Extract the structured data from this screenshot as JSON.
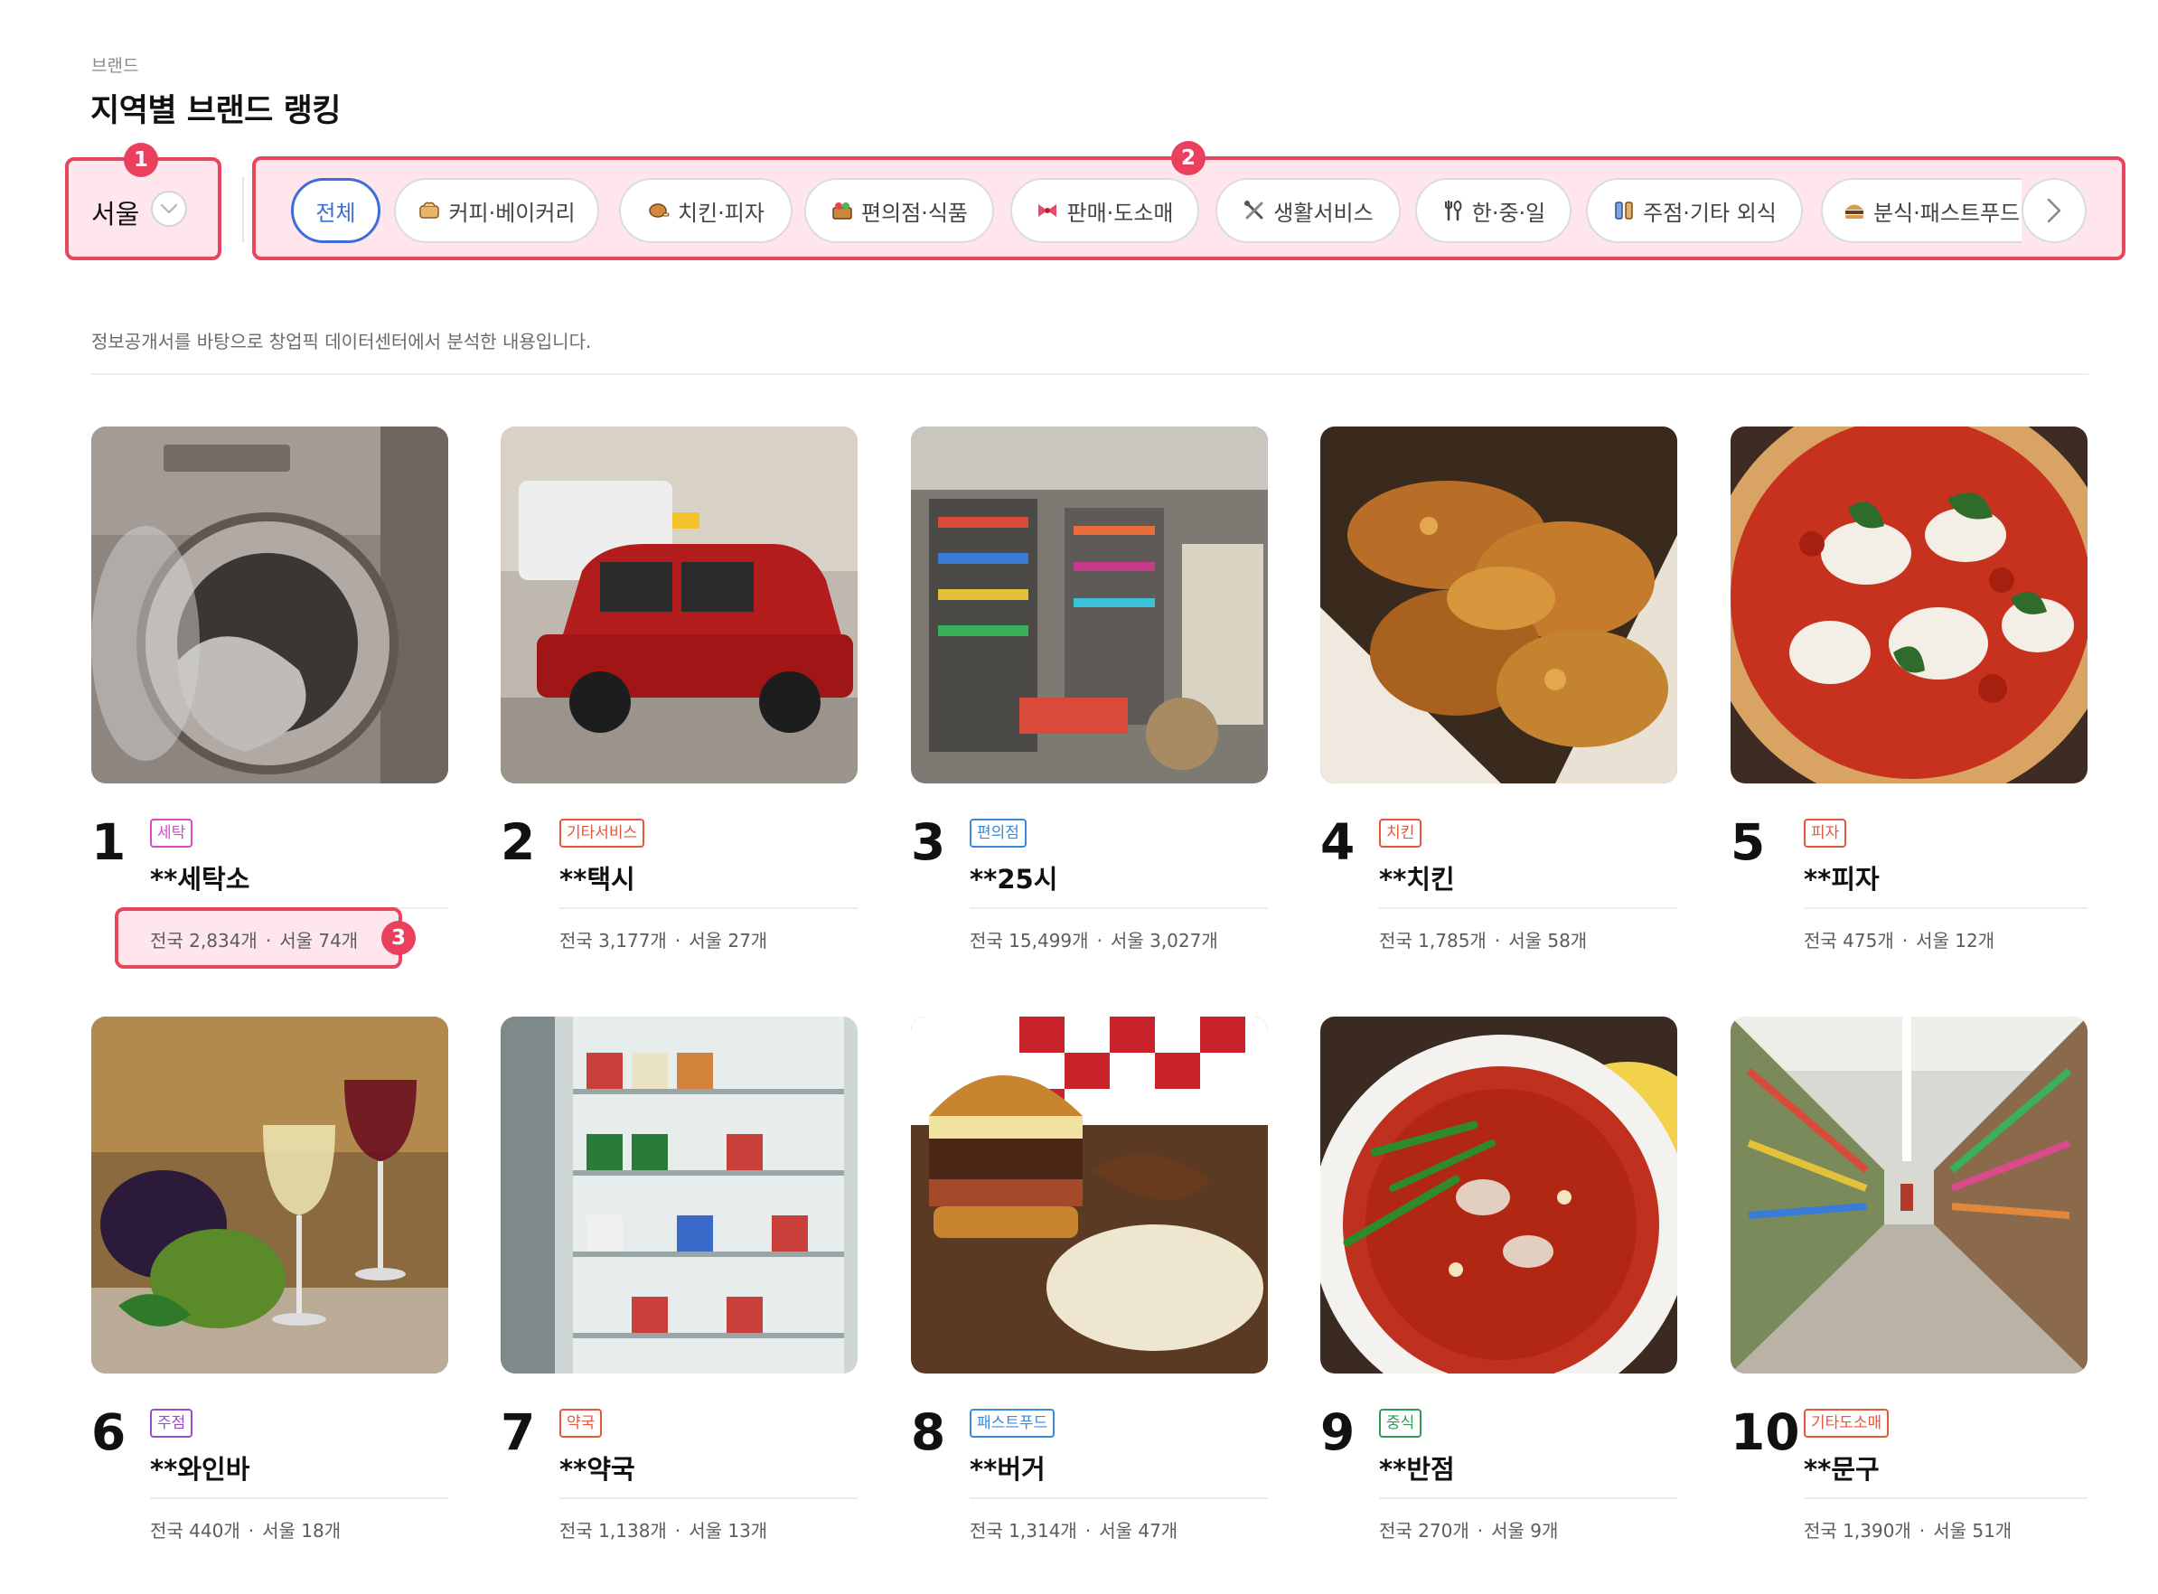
{
  "header": {
    "breadcrumb": "브랜드",
    "title": "지역별 브랜드 랭킹"
  },
  "region_select": {
    "value": "서울",
    "icon": "chevron-down-icon"
  },
  "categories": [
    {
      "label": "전체",
      "icon": null,
      "active": true
    },
    {
      "label": "커피·베이커리",
      "icon": "bread-icon"
    },
    {
      "label": "치킨·피자",
      "icon": "chicken-icon"
    },
    {
      "label": "편의점·식품",
      "icon": "grocery-icon"
    },
    {
      "label": "판매·도소매",
      "icon": "gift-icon"
    },
    {
      "label": "생활서비스",
      "icon": "tools-icon"
    },
    {
      "label": "한·중·일",
      "icon": "utensils-icon"
    },
    {
      "label": "주점·기타 외식",
      "icon": "drinks-icon"
    },
    {
      "label": "분식·패스트푸드",
      "icon": "burger-icon"
    }
  ],
  "annotations": [
    "1",
    "2",
    "3"
  ],
  "notice": "정보공개서를 바탕으로 창업픽 데이터센터에서 분석한 내용입니다.",
  "colors": {
    "highlight": "#e8455f",
    "active_chip": "#3e6dd8"
  },
  "brands": [
    {
      "rank": "1",
      "tag": "세탁",
      "tag_color": "#d94bc9",
      "name": "**세탁소",
      "nation_label": "전국",
      "nation": "2,834개",
      "region_label": "서울",
      "region": "74개",
      "image": "washing-machine"
    },
    {
      "rank": "2",
      "tag": "기타서비스",
      "tag_color": "#e3573b",
      "name": "**택시",
      "nation_label": "전국",
      "nation": "3,177개",
      "region_label": "서울",
      "region": "27개",
      "image": "red-taxi"
    },
    {
      "rank": "3",
      "tag": "편의점",
      "tag_color": "#3b8ad9",
      "name": "**25시",
      "nation_label": "전국",
      "nation": "15,499개",
      "region_label": "서울",
      "region": "3,027개",
      "image": "convenience-store"
    },
    {
      "rank": "4",
      "tag": "치킨",
      "tag_color": "#e3573b",
      "name": "**치킨",
      "nation_label": "전국",
      "nation": "1,785개",
      "region_label": "서울",
      "region": "58개",
      "image": "fried-chicken"
    },
    {
      "rank": "5",
      "tag": "피자",
      "tag_color": "#e3573b",
      "name": "**피자",
      "nation_label": "전국",
      "nation": "475개",
      "region_label": "서울",
      "region": "12개",
      "image": "pizza"
    },
    {
      "rank": "6",
      "tag": "주점",
      "tag_color": "#9a4bd4",
      "name": "**와인바",
      "nation_label": "전국",
      "nation": "440개",
      "region_label": "서울",
      "region": "18개",
      "image": "wine"
    },
    {
      "rank": "7",
      "tag": "약국",
      "tag_color": "#e3573b",
      "name": "**약국",
      "nation_label": "전국",
      "nation": "1,138개",
      "region_label": "서울",
      "region": "13개",
      "image": "pharmacy"
    },
    {
      "rank": "8",
      "tag": "패스트푸드",
      "tag_color": "#3b8ad9",
      "name": "**버거",
      "nation_label": "전국",
      "nation": "1,314개",
      "region_label": "서울",
      "region": "47개",
      "image": "burger"
    },
    {
      "rank": "9",
      "tag": "중식",
      "tag_color": "#2e9a55",
      "name": "**반점",
      "nation_label": "전국",
      "nation": "270개",
      "region_label": "서울",
      "region": "9개",
      "image": "jjamppong"
    },
    {
      "rank": "10",
      "tag": "기타도소매",
      "tag_color": "#e3573b",
      "name": "**문구",
      "nation_label": "전국",
      "nation": "1,390개",
      "region_label": "서울",
      "region": "51개",
      "image": "supermarket-aisle"
    }
  ]
}
